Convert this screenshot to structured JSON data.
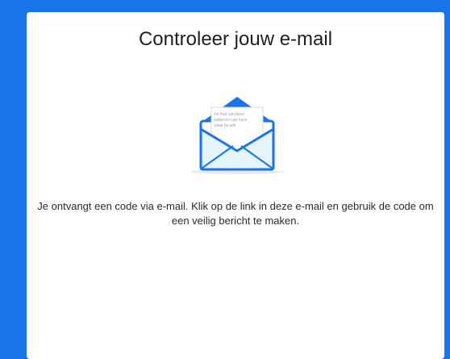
{
  "dialog": {
    "title": "Controleer jouw e-mail",
    "message": "Je ontvangt een code via e-mail. Klik op de link in deze e-mail en gebruik de code om een veilig bericht te maken."
  },
  "illustration": {
    "icon": "open-envelope-icon",
    "letter_lines": [
      "he that can have",
      "patience can have",
      "what he will"
    ]
  },
  "colors": {
    "background": "#1a73e8",
    "accent": "#1a73e8",
    "card": "#ffffff",
    "envelope_fill": "#e6f4fb"
  }
}
